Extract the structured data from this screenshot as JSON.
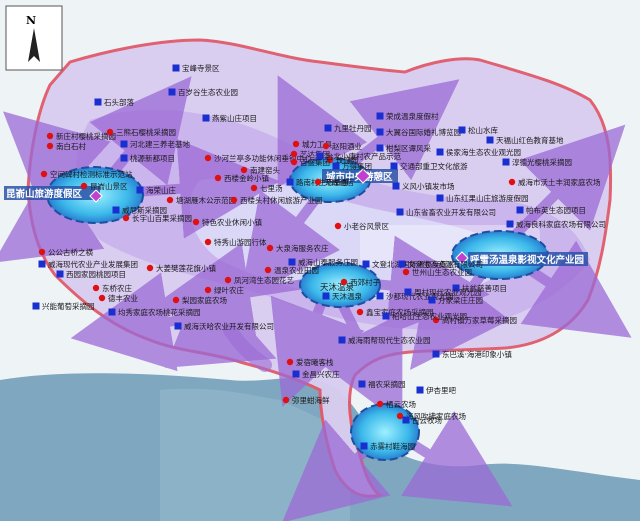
{
  "compass": {
    "letter": "N"
  },
  "colors": {
    "sea": "#7fa7bf",
    "land": "#e8eef2",
    "border": "#e05a6a",
    "route": "#8a5ac8",
    "poi_red": "#e01010",
    "poi_blue": "#1a2fd0",
    "zone_core": "#39b8e8",
    "zone_outline": "#1d4fa0"
  },
  "zones": [
    {
      "name": "昆嵛山旅游度假区"
    },
    {
      "name": "城市中央游憩区"
    },
    {
      "name": "天沐温泉"
    },
    {
      "name": "呼雷汤温泉影视文化产业园"
    }
  ],
  "labels": [
    {
      "text": "宝峰寺景区"
    },
    {
      "text": "百岁谷生态农业园"
    },
    {
      "text": "石头部落"
    },
    {
      "text": "燕紫山庄项目"
    },
    {
      "text": "新庄村樱桃采摘园"
    },
    {
      "text": "南白石村"
    },
    {
      "text": "三熊石樱桃采摘园"
    },
    {
      "text": "河北建三养老基地"
    },
    {
      "text": "桃源新都项目"
    },
    {
      "text": "空间碑村检测标准示范站"
    },
    {
      "text": "昆嵛山景区"
    },
    {
      "text": "海荣山庄"
    },
    {
      "text": "威尼斯采摘园"
    },
    {
      "text": "沙河兰亭多功能休闲垂钓中心"
    },
    {
      "text": "西楼金岭小镇"
    },
    {
      "text": "南建窑头"
    },
    {
      "text": "玫瑰园"
    },
    {
      "text": "七里汤"
    },
    {
      "text": "路南村生态旅游"
    },
    {
      "text": "天辉酒店"
    },
    {
      "text": "城力工具"
    },
    {
      "text": "艺达集团"
    },
    {
      "text": "赵阳酒业"
    },
    {
      "text": "九里牡丹园"
    },
    {
      "text": "百盛集团"
    },
    {
      "text": "万得集团"
    },
    {
      "text": "台北小康村农产品示范"
    },
    {
      "text": "交通部重卫文化旅游"
    },
    {
      "text": "义风小镇发市场"
    },
    {
      "text": "荣成温泉度假村"
    },
    {
      "text": "大翼谷国际婚礼博览园"
    },
    {
      "text": "松山水库"
    },
    {
      "text": "柑梨区谭风采"
    },
    {
      "text": "天福山红色教育基地"
    },
    {
      "text": "侯家海生态农业观光园"
    },
    {
      "text": "淳德光樱桃采摘园"
    },
    {
      "text": "威海市沃土丰润家庭农场"
    },
    {
      "text": "山东红果山庄旅游度假园"
    },
    {
      "text": "山东省畜农业开发有限公司"
    },
    {
      "text": "帕布英生态园项目"
    },
    {
      "text": "威海良科家庭农场有限公司"
    },
    {
      "text": "长宇山百果采摘园"
    },
    {
      "text": "塘湖雁木公示范园"
    },
    {
      "text": "西楼头村休闲旅游产业园"
    },
    {
      "text": "小老谷风景区"
    },
    {
      "text": "威海山泰服务庄园"
    },
    {
      "text": "大泉海服务农庄"
    },
    {
      "text": "特色农业休闲小镇"
    },
    {
      "text": "特秀山游园行体"
    },
    {
      "text": "公公古桥之横"
    },
    {
      "text": "威海现代农业产业发展集团"
    },
    {
      "text": "西园家园桃园项目"
    },
    {
      "text": "大姜樊莲花旗小镇"
    },
    {
      "text": "凤河湾生态园花艺"
    },
    {
      "text": "绿叶农庄"
    },
    {
      "text": "梨园家庭农场"
    },
    {
      "text": "东桥农庄"
    },
    {
      "text": "德丰农业"
    },
    {
      "text": "兴能葡萄采摘园"
    },
    {
      "text": "均秀家庭农场桃花采摘园"
    },
    {
      "text": "威海沃哈农业开发有限公司"
    },
    {
      "text": "温泉农业田园"
    },
    {
      "text": "天沐温泉"
    },
    {
      "text": "西郊村子"
    },
    {
      "text": "沙都现代农业观光园"
    },
    {
      "text": "鑫宝家庭农场采摘园"
    },
    {
      "text": "文登北湖国际温泉度假区"
    },
    {
      "text": "文登生态资源有限公司"
    },
    {
      "text": "世州山生态农业园"
    },
    {
      "text": "扶贫慈善项目"
    },
    {
      "text": "方家梁庄庄园"
    },
    {
      "text": "周村现代农业观光园"
    },
    {
      "text": "高村镇万家草莓采摘园"
    },
    {
      "text": "柘哈山生态农业观光园"
    },
    {
      "text": "威海雨帮现代生态农业园"
    },
    {
      "text": "爱宿曦客栈"
    },
    {
      "text": "金昌兴农庄"
    },
    {
      "text": "福农采摘园"
    },
    {
      "text": "弥里蚶海鲜"
    },
    {
      "text": "栖云农场"
    },
    {
      "text": "伊杏里吧"
    },
    {
      "text": "海风吹拂家庭农场"
    },
    {
      "text": "白云牧场"
    },
    {
      "text": "赤雾村鞋海园"
    },
    {
      "text": "东巴溪·海港印象小镇"
    }
  ]
}
